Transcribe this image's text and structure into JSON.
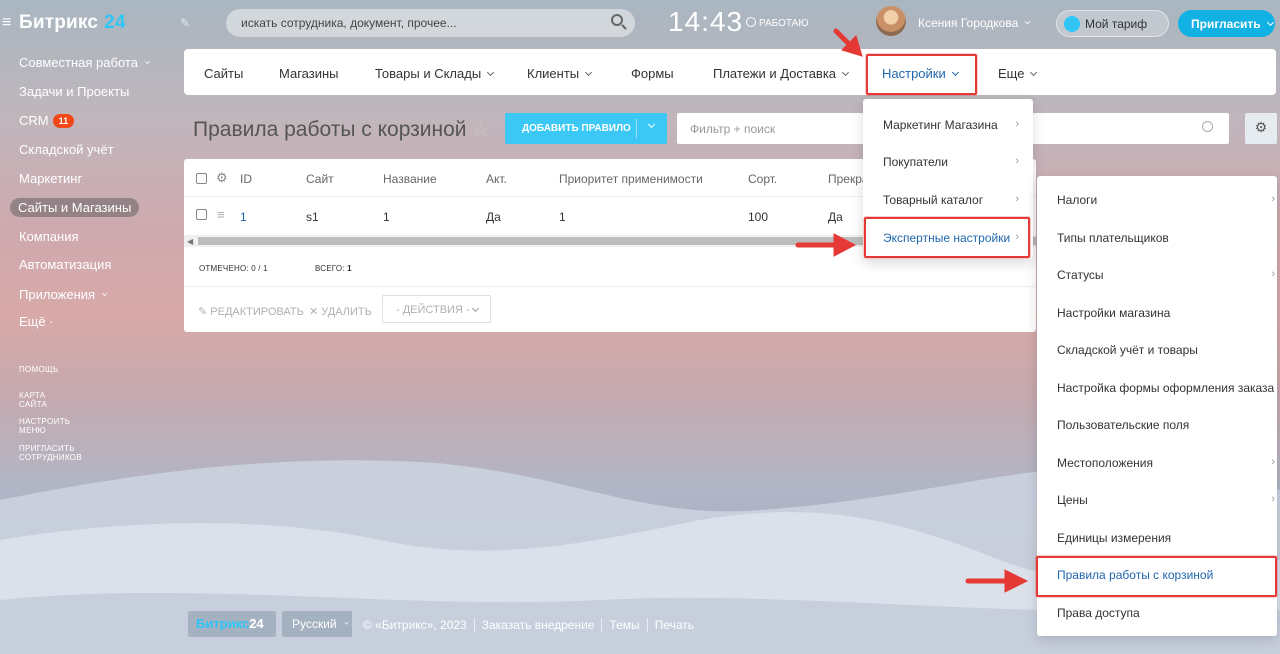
{
  "header": {
    "logo": "Битрикс",
    "logo_number": "24",
    "search_placeholder": "искать сотрудника, документ, прочее...",
    "clock": "14:43",
    "work_status": "РАБОТАЮ",
    "user_name": "Ксения Городкова",
    "tariff_label": "Мой тариф",
    "invite_label": "Пригласить"
  },
  "sidebar": {
    "items": [
      {
        "label": "Совместная работа"
      },
      {
        "label": "Задачи и Проекты"
      },
      {
        "label": "CRM",
        "badge": "11"
      },
      {
        "label": "Складской учёт"
      },
      {
        "label": "Маркетинг"
      },
      {
        "label": "Сайты и Магазины"
      },
      {
        "label": "Компания"
      },
      {
        "label": "Автоматизация"
      },
      {
        "label": "Приложения"
      },
      {
        "label": "Ещё ·"
      }
    ],
    "links": [
      "ПОМОЩЬ",
      "КАРТА САЙТА",
      "НАСТРОИТЬ МЕНЮ",
      "ПРИГЛАСИТЬ СОТРУДНИКОВ"
    ]
  },
  "topnav": {
    "items": [
      "Сайты",
      "Магазины",
      "Товары и Склады",
      "Клиенты",
      "Формы",
      "Платежи и Доставка",
      "Настройки",
      "Еще"
    ]
  },
  "page": {
    "title": "Правила работы с корзиной",
    "add_button": "ДОБАВИТЬ ПРАВИЛО",
    "filter_placeholder": "Фильтр + поиск"
  },
  "grid": {
    "headers": [
      "ID",
      "Сайт",
      "Название",
      "Акт.",
      "Приоритет применимости",
      "Сорт.",
      "Прекра"
    ],
    "row": [
      "1",
      "s1",
      "1",
      "Да",
      "1",
      "100",
      "Да"
    ],
    "selected": "ОТМЕЧЕНО: 0 / 1",
    "total_label": "ВСЕГО:",
    "total_value": "1",
    "edit": "РЕДАКТИРОВАТЬ",
    "delete": "УДАЛИТЬ",
    "actions": "- ДЕЙСТВИЯ -"
  },
  "menu_settings": {
    "items": [
      {
        "label": "Маркетинг Магазина",
        "arrow": "›"
      },
      {
        "label": "Покупатели",
        "arrow": "›"
      },
      {
        "label": "Товарный каталог",
        "arrow": "›"
      },
      {
        "label": "Экспертные настройки",
        "arrow": "›"
      }
    ]
  },
  "menu_expert": {
    "items": [
      {
        "label": "Налоги",
        "arrow": "›"
      },
      {
        "label": "Типы плательщиков"
      },
      {
        "label": "Статусы",
        "arrow": "›"
      },
      {
        "label": "Настройки магазина"
      },
      {
        "label": "Складской учёт и товары"
      },
      {
        "label": "Настройка формы оформления заказа"
      },
      {
        "label": "Пользовательские поля"
      },
      {
        "label": "Местоположения",
        "arrow": "›"
      },
      {
        "label": "Цены",
        "arrow": "›"
      },
      {
        "label": "Единицы измерения"
      },
      {
        "label": "Правила работы с корзиной"
      },
      {
        "label": "Права доступа"
      }
    ]
  },
  "footer": {
    "brand": "Битрикс",
    "brand_number": "24",
    "language": "Русский",
    "links": [
      "© «Битрикс», 2023",
      "Заказать внедрение",
      "Темы",
      "Печать"
    ]
  },
  "colors": {
    "accent": "#2fc6f6",
    "link": "#2067b0",
    "highlight": "#e53935",
    "badge": "#f54819"
  }
}
